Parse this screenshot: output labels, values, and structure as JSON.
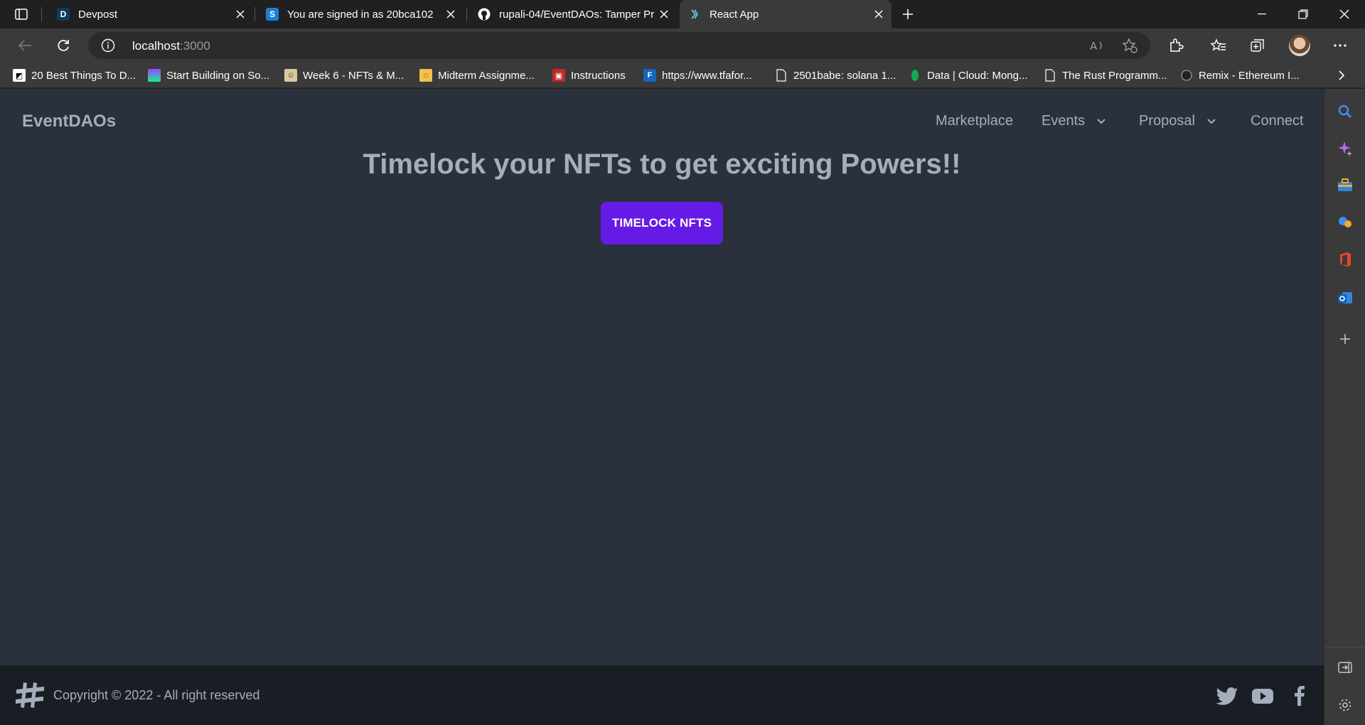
{
  "browser": {
    "tabs": [
      {
        "title": "Devpost",
        "favicon_letter": "D"
      },
      {
        "title": "You are signed in as 20bca102",
        "favicon_letter": "S"
      },
      {
        "title": "rupali-04/EventDAOs: Tamper Pr",
        "favicon_letter": ""
      },
      {
        "title": "React App",
        "favicon_letter": ""
      }
    ],
    "address": {
      "host": "localhost",
      "port": ":3000"
    },
    "bookmarks": [
      {
        "label": "20 Best Things To D..."
      },
      {
        "label": "Start Building on So..."
      },
      {
        "label": "Week 6 - NFTs & M..."
      },
      {
        "label": "Midterm Assignme..."
      },
      {
        "label": "Instructions"
      },
      {
        "label": "https://www.tfafor..."
      },
      {
        "label": "2501babe: solana 1..."
      },
      {
        "label": "Data | Cloud: Mong..."
      },
      {
        "label": "The Rust Programm..."
      },
      {
        "label": "Remix - Ethereum I..."
      }
    ]
  },
  "site": {
    "brand": "EventDAOs",
    "nav": {
      "marketplace": "Marketplace",
      "events": "Events",
      "proposal": "Proposal",
      "connect": "Connect"
    },
    "hero": {
      "title": "Timelock your NFTs to get exciting Powers!!",
      "button": "TIMELOCK NFTS"
    },
    "footer": {
      "copyright": "Copyright © 2022 - All right reserved"
    }
  },
  "colors": {
    "page_bg": "#2a303c",
    "footer_bg": "#191e24",
    "primary": "#661ae6",
    "text_muted": "#a6adbb"
  }
}
